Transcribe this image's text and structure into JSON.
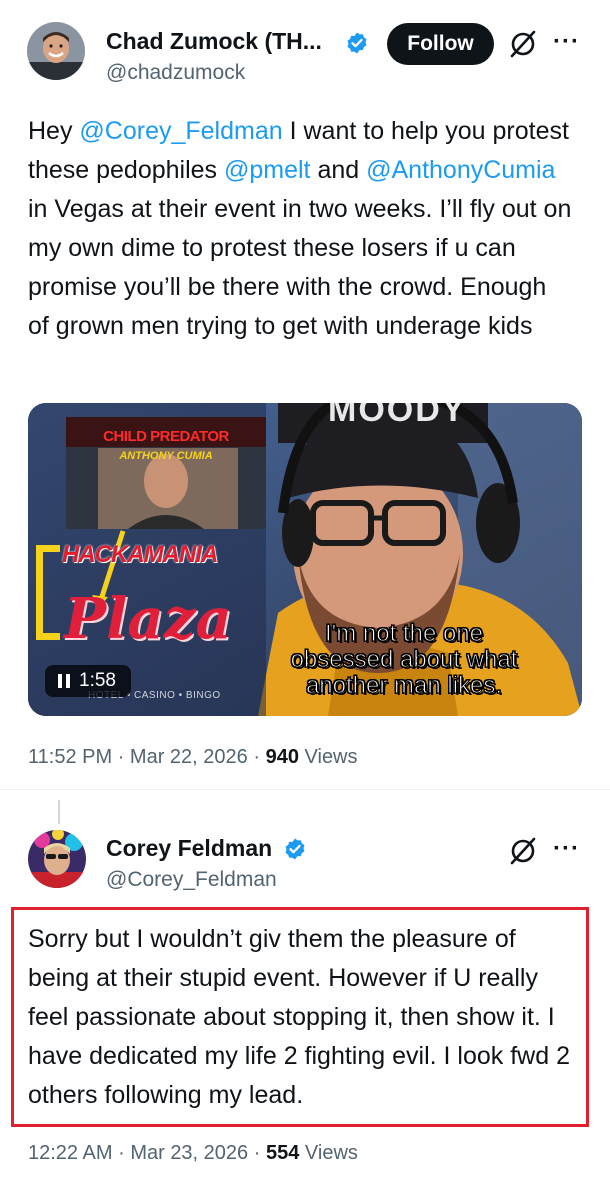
{
  "tweet1": {
    "display_name": "Chad Zumock (TH...",
    "handle": "@chadzumock",
    "follow_label": "Follow",
    "more_label": "···",
    "text": {
      "p1": "Hey ",
      "m1": "@Corey_Feldman",
      "p2": " I want to help you protest these pedophiles ",
      "m2": "@pmelt",
      "p3": " and ",
      "m3": "@AnthonyCumia",
      "p4": " in Vegas at their event in two weeks. I’ll fly out on my own dime to protest these losers if u can promise you’ll be there with the crowd. Enough of grown men trying to get with underage kids"
    },
    "media": {
      "banner_top": "CHILD PREDATOR",
      "banner_name": "ANTHONY CUMIA",
      "logo_word": "HACKAMANIA",
      "logo_plaza": "Plaza",
      "logo_sub": "HOTEL • CASINO • BINGO",
      "hat_text": "MOODY",
      "subtitle_line1": "I'm not the one",
      "subtitle_line2": "obsessed about what",
      "subtitle_line3": "another man likes.",
      "pause_icon": "pause-icon",
      "duration": "1:58"
    },
    "time": "11:52 PM",
    "sep": "·",
    "date": "Mar 22, 2026",
    "views_count": "940",
    "views_label": "Views"
  },
  "tweet2": {
    "display_name": "Corey Feldman",
    "handle": "@Corey_Feldman",
    "more_label": "···",
    "text": "Sorry but I wouldn’t giv them the pleasure of being at their stupid event. However if U really feel passionate about stopping it, then show it. I have dedicated my life 2 fighting evil. I look fwd 2 others following my lead.",
    "time": "12:22 AM",
    "sep": "·",
    "date": "Mar 23, 2026",
    "views_count": "554",
    "views_label": "Views"
  },
  "colors": {
    "mention": "#1d9bf0",
    "verified": "#1d9bf0",
    "highlight": "#e0202c",
    "secondary_text": "#536471"
  }
}
